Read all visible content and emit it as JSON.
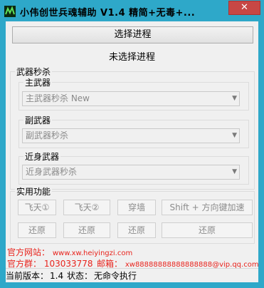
{
  "window": {
    "title": "小伟创世兵魂辅助 V1.4 精简+无毒+...",
    "close_symbol": "✕"
  },
  "process": {
    "select_button": "选择进程",
    "status": "未选择进程"
  },
  "weapons": {
    "group_title": "武器秒杀",
    "primary": {
      "label": "主武器",
      "value": "主武器秒杀 New"
    },
    "secondary": {
      "label": "副武器",
      "value": "副武器秒杀"
    },
    "melee": {
      "label": "近身武器",
      "value": "近身武器秒杀"
    }
  },
  "functions": {
    "group_title": "实用功能",
    "row1": [
      "飞天①",
      "飞天②",
      "穿墙",
      "Shift + 方向键加速"
    ],
    "row2": [
      "还原",
      "还原",
      "还原",
      "还原"
    ]
  },
  "footer": {
    "website_label": "官方网站：",
    "website_value": "www.xw.heiyingzi.com",
    "group_label": "官方群：",
    "group_value": "103033778",
    "email_label": "邮箱：",
    "email_value": "xw88888888888888888@vip.qq.com"
  },
  "statusbar": {
    "version_label": "当前版本：",
    "version_value": "1.4",
    "state_label": "状态：",
    "state_value": "无命令执行"
  },
  "colors": {
    "frame": "#2ea8c9",
    "close": "#c74745",
    "link_red": "#e8231c"
  }
}
